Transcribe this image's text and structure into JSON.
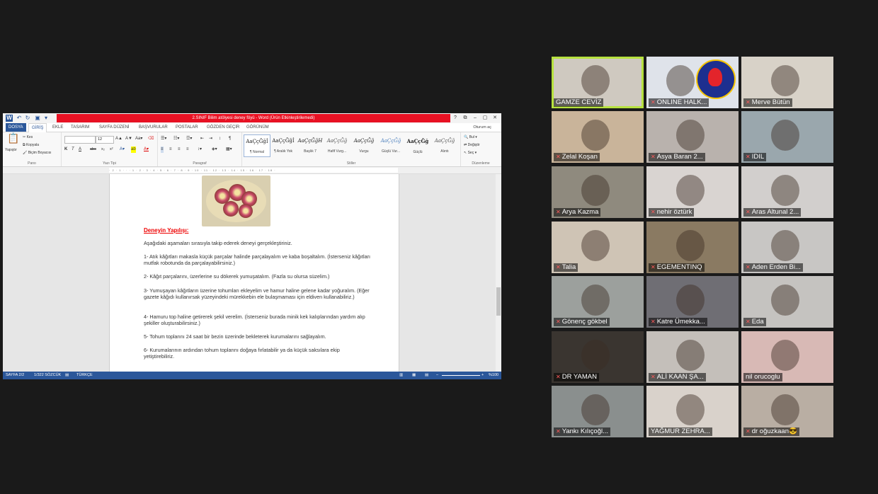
{
  "word": {
    "title": "2.SINIF Bilim atölyesi deney föyü - Word (Ürün Etkinleştirilemedi)",
    "quick_access": {
      "save_icon": "save-icon",
      "undo_icon": "undo-icon",
      "redo_icon": "redo-icon"
    },
    "window_controls": [
      "?",
      "⧉",
      "–",
      "▢",
      "✕"
    ],
    "tabs": [
      "DOSYA",
      "GİRİŞ",
      "EKLE",
      "TASARIM",
      "SAYFA DÜZENİ",
      "BAŞVURULAR",
      "POSTALAR",
      "GÖZDEN GEÇİR",
      "GÖRÜNÜM"
    ],
    "active_tab": "GİRİŞ",
    "account": "Oturum aç",
    "clipboard": {
      "paste": "Yapıştır",
      "cut": "Kes",
      "copy": "Kopyala",
      "format_painter": "Biçim Boyacısı",
      "label": "Pano"
    },
    "font": {
      "family": "",
      "size": "12",
      "label": "Yazı Tipi",
      "buttons": [
        "K",
        "T",
        "A",
        "abc",
        "x₂",
        "x²"
      ]
    },
    "paragraph": {
      "label": "Paragraf"
    },
    "styles": {
      "label": "Stiller",
      "items": [
        {
          "preview": "AaÇçĞğİ",
          "name": "¶ Normal"
        },
        {
          "preview": "AaÇçĞğİ",
          "name": "¶ Aralık Yok"
        },
        {
          "preview": "AaÇçĞğH",
          "name": "Başlık 7"
        },
        {
          "preview": "AaÇçĞğ",
          "name": "Hafif Vurg..."
        },
        {
          "preview": "AaÇçĞğ",
          "name": "Vurgu"
        },
        {
          "preview": "AaÇçĞğ",
          "name": "Güçlü Vur..."
        },
        {
          "preview": "AaÇçĞğ",
          "name": "Güçlü"
        },
        {
          "preview": "AaÇçĞğ",
          "name": "Alıntı"
        }
      ]
    },
    "editing": {
      "find": "Bul",
      "replace": "Değiştir",
      "select": "Seç",
      "label": "Düzenleme"
    },
    "ruler": "· 2 · 1 · · · 1 · 2 · 3 · 4 · 5 · 6 · 7 · 8 · 9 · 10 · 11 · 12 · 13 · 14 · 15 · 16 · 17 · 18 ·",
    "document": {
      "heading": "Deneyin Yapılışı:",
      "paragraphs": [
        "Aşağıdaki aşamaları sırasıyla takip ederek deneyi gerçekleştiriniz.",
        "1- Atık kâğıtları makasla küçük parçalar halinde parçalayalım ve kaba boşaltalım. (İsterseniz kâğıtları mutfak robotunda da parçalayabilirsiniz.)",
        "2- Kâğıt parçalarını, üzerlerine su dökerek yumuşatalım. (Fazla su olursa süzelim.)",
        "3- Yumuşayan kâğıtların üzerine tohumları ekleyelim ve hamur haline gelene kadar yoğuralım. (Eğer gazete kâğıdı kullanırsak yüzeyindeki mürekkebin ele bulaşmaması için eldiven kullanabiliriz.)",
        "4- Hamuru top haline getirerek şekil verelim. (İsterseniz burada minik kek kalıplarından yardım alıp şekiller oluşturabilirsiniz.)",
        "5- Tohum toplarını 24 saat bir bezin üzerinde bekleterek kurumalarını sağlayalım.",
        "6- Kurumalarının ardından tohum toplarını doğaya fırlatabilir ya da küçük saksılara ekip yetiştirebiliriz."
      ]
    },
    "status": {
      "page": "SAYFA 2/2",
      "words": "1/322 SÖZCÜK",
      "language": "TÜRKÇE",
      "zoom": "%100"
    }
  },
  "participants": [
    {
      "name": "GAMZE CEVİZ",
      "muted": false,
      "active": true,
      "bg": "#cfc9c0"
    },
    {
      "name": "ONLINE HALK...",
      "muted": true,
      "active": false,
      "bg": "#dfe3ea",
      "logo": true
    },
    {
      "name": "Merve Bütün",
      "muted": true,
      "active": false,
      "bg": "#d8d2c8"
    },
    {
      "name": "Zelal Koşan",
      "muted": true,
      "active": false,
      "bg": "#c9b49a"
    },
    {
      "name": "Asya Baran   2...",
      "muted": true,
      "active": false,
      "bg": "#b9b2ad"
    },
    {
      "name": "IDIL",
      "muted": true,
      "active": false,
      "bg": "#9aa7ad"
    },
    {
      "name": "Arya Kazma",
      "muted": true,
      "active": false,
      "bg": "#8f8a7e"
    },
    {
      "name": "nehir öztürk",
      "muted": true,
      "active": false,
      "bg": "#d9d4d1"
    },
    {
      "name": "Aras Altunal 2...",
      "muted": true,
      "active": false,
      "bg": "#d2cfcd"
    },
    {
      "name": "Talia",
      "muted": true,
      "active": false,
      "bg": "#cfc4b5"
    },
    {
      "name": "EGEMENTINQ",
      "muted": true,
      "active": false,
      "bg": "#8a7a62"
    },
    {
      "name": "Aden Erden Bi...",
      "muted": true,
      "active": false,
      "bg": "#c8c6c4"
    },
    {
      "name": "Gönenç gökbel",
      "muted": true,
      "active": false,
      "bg": "#9ca09d"
    },
    {
      "name": "Katre Ümekka...",
      "muted": true,
      "active": false,
      "bg": "#6f6e74"
    },
    {
      "name": "Eda",
      "muted": true,
      "active": false,
      "bg": "#c5c3c0"
    },
    {
      "name": "DR YAMAN",
      "muted": true,
      "active": false,
      "bg": "#3a3530"
    },
    {
      "name": "ALİ KAAN ŞA...",
      "muted": true,
      "active": false,
      "bg": "#c4bfba"
    },
    {
      "name": "nil orucoglu",
      "muted": false,
      "active": false,
      "bg": "#d8b9b5"
    },
    {
      "name": "Yankı Kılıçoğl...",
      "muted": true,
      "active": false,
      "bg": "#8a8f8e"
    },
    {
      "name": "YAĞMUR ZEHRA...",
      "muted": false,
      "active": false,
      "bg": "#d9d2cb"
    },
    {
      "name": "dr oğuzkaan😎",
      "muted": true,
      "active": false,
      "bg": "#b9aea3"
    }
  ],
  "colors": {
    "word_blue": "#2b579a",
    "title_red": "#e81123",
    "active_speaker": "#b7e23f",
    "muted_red": "#ff5a5a"
  },
  "icons": {
    "mute": "microphone-muted-icon"
  }
}
